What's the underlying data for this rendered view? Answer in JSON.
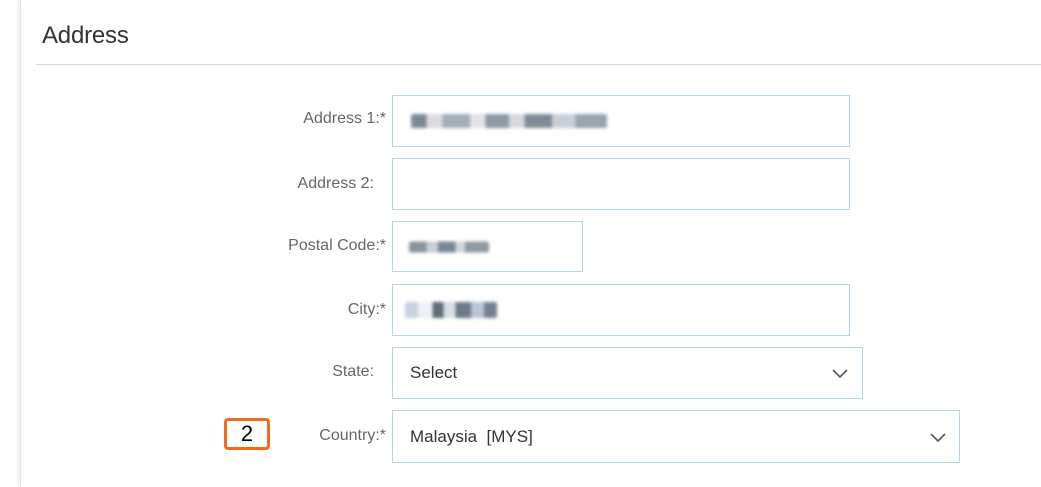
{
  "section": {
    "title": "Address"
  },
  "fields": {
    "address1": {
      "label": "Address 1:*"
    },
    "address2": {
      "label": "Address 2:"
    },
    "postal_code": {
      "label": "Postal Code:*"
    },
    "city": {
      "label": "City:*"
    },
    "state": {
      "label": "State:",
      "value": "Select"
    },
    "country": {
      "label": "Country:*",
      "value": "Malaysia  [MYS]"
    }
  },
  "annotation": {
    "step": "2",
    "color": "#f26b1d"
  },
  "colors": {
    "field_border": "#b6d5e6",
    "label": "#666666",
    "text": "#333333"
  },
  "icons": {
    "dropdown": "chevron-down-icon"
  }
}
